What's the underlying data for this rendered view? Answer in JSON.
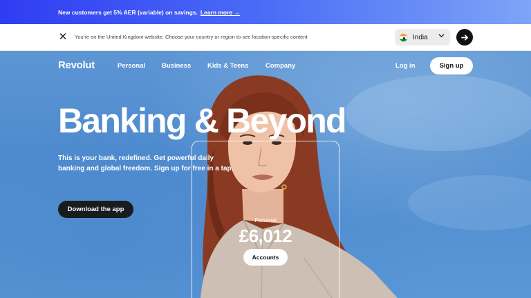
{
  "promo": {
    "text": "New customers get 5% AER (variable) on savings.",
    "link": "Learn more →"
  },
  "region_bar": {
    "close_icon": "close-icon",
    "message": "You’re on the United Kingdom website. Choose your country or region to see location-specific content",
    "country": "India",
    "country_flag": "india-flag-icon",
    "chevron": "⌄",
    "go_arrow": "→"
  },
  "nav": {
    "logo": "Revolut",
    "items": [
      "Personal",
      "Business",
      "Kids & Teens",
      "Company"
    ],
    "login": "Log in",
    "signup": "Sign up"
  },
  "hero": {
    "headline": "Banking & Beyond",
    "subline": "This is your bank, redefined. Get powerful daily banking and global freedom. Sign up for free in a tap.",
    "cta": "Download the app"
  },
  "card": {
    "label": "Personal",
    "amount": "£6,012",
    "button": "Accounts"
  },
  "colors": {
    "promo_start": "#2f3cf2",
    "promo_end": "#7ea4f7",
    "sky": "#5a97d6",
    "dark_button": "#191c1f"
  }
}
